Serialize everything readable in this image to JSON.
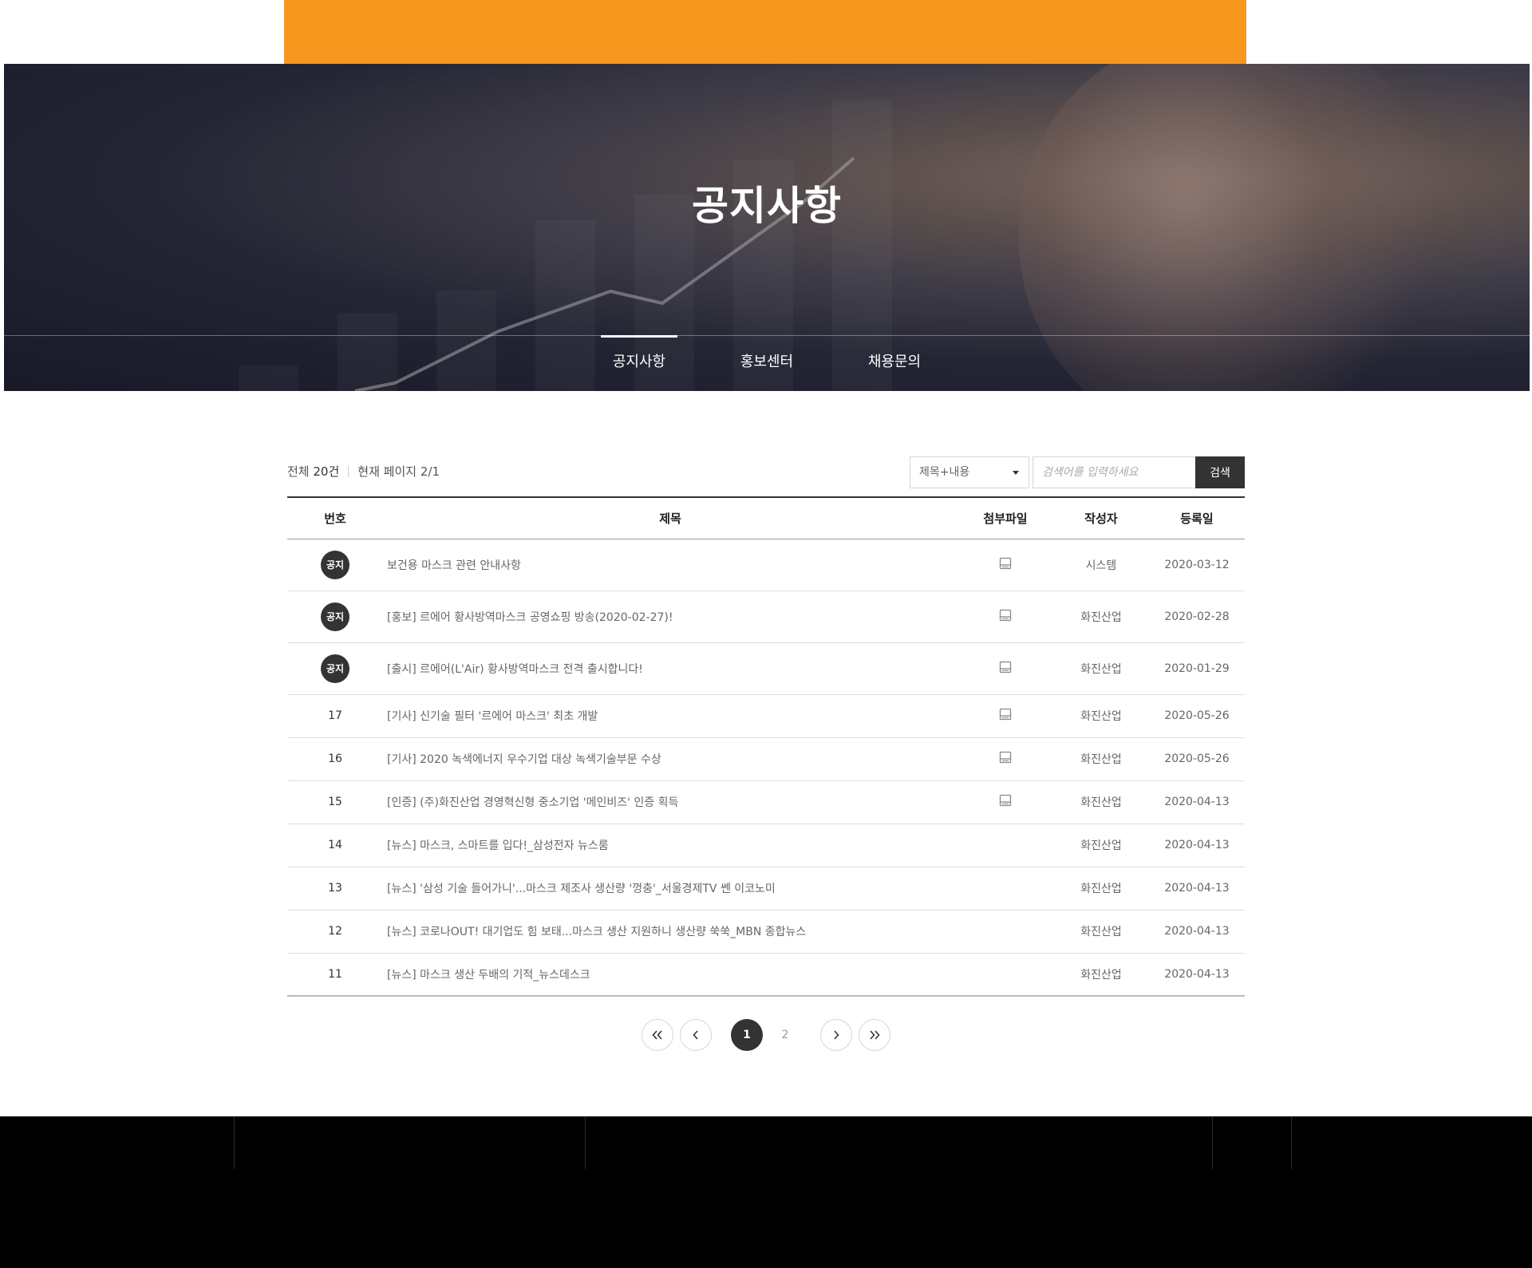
{
  "hero": {
    "title": "공지사항",
    "tabs": [
      {
        "label": "공지사항",
        "active": true
      },
      {
        "label": "홍보센터",
        "active": false
      },
      {
        "label": "채용문의",
        "active": false
      }
    ]
  },
  "board": {
    "total_label": "전체",
    "total_count": "20건",
    "page_label": "현재 페이지",
    "page_value": "2/1",
    "search": {
      "select_value": "제목+내용",
      "placeholder": "검색어를 입력하세요",
      "button_label": "검색"
    },
    "columns": [
      "번호",
      "제목",
      "첨부파일",
      "작성자",
      "등록일"
    ],
    "rows": [
      {
        "no": "공지",
        "notice": true,
        "title": "보건용 마스크 관련 안내사항",
        "file": true,
        "writer": "시스템",
        "date": "2020-03-12"
      },
      {
        "no": "공지",
        "notice": true,
        "title": "[홍보] 르에어 황사방역마스크 공영쇼핑 방송(2020-02-27)!",
        "file": true,
        "writer": "화진산업",
        "date": "2020-02-28"
      },
      {
        "no": "공지",
        "notice": true,
        "title": "[출시] 르에어(L'Air) 황사방역마스크 전격 출시합니다!",
        "file": true,
        "writer": "화진산업",
        "date": "2020-01-29"
      },
      {
        "no": "17",
        "notice": false,
        "title": "[기사] 신기술 필터 '르에어 마스크' 최초 개발",
        "file": true,
        "writer": "화진산업",
        "date": "2020-05-26"
      },
      {
        "no": "16",
        "notice": false,
        "title": "[기사] 2020 녹색에너지 우수기업 대상 녹색기술부문 수상",
        "file": true,
        "writer": "화진산업",
        "date": "2020-05-26"
      },
      {
        "no": "15",
        "notice": false,
        "title": "[인증] (주)화진산업 경영혁신형 중소기업 '메인비즈' 인증 획득",
        "file": true,
        "writer": "화진산업",
        "date": "2020-04-13"
      },
      {
        "no": "14",
        "notice": false,
        "title": "[뉴스] 마스크, 스마트를 입다!_삼성전자 뉴스룸",
        "file": false,
        "writer": "화진산업",
        "date": "2020-04-13"
      },
      {
        "no": "13",
        "notice": false,
        "title": "[뉴스] '삼성 기술 들어가니'...마스크 제조사 생산량 '껑충'_서울경제TV 쎈 이코노미",
        "file": false,
        "writer": "화진산업",
        "date": "2020-04-13"
      },
      {
        "no": "12",
        "notice": false,
        "title": "[뉴스] 코로나OUT! 대기업도 힘 보태...마스크 생산 지원하니 생산량 쑥쑥_MBN 종합뉴스",
        "file": false,
        "writer": "화진산업",
        "date": "2020-04-13"
      },
      {
        "no": "11",
        "notice": false,
        "title": "[뉴스] 마스크 생산 두배의 기적_뉴스데스크",
        "file": false,
        "writer": "화진산업",
        "date": "2020-04-13"
      }
    ]
  },
  "pagination": {
    "pages": [
      "1",
      "2"
    ],
    "current": "1"
  },
  "colors": {
    "accent": "#f7971e",
    "dark": "#333333",
    "footer": "#000000"
  }
}
